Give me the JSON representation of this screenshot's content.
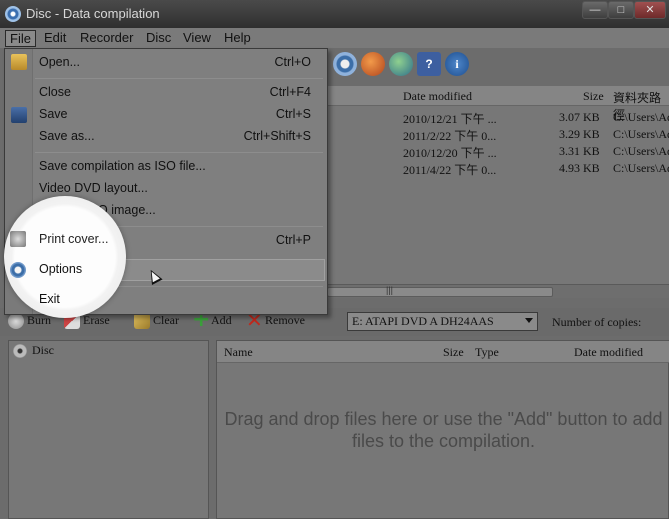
{
  "window": {
    "title": "Disc - Data compilation",
    "controls": [
      "—",
      "□",
      "✕"
    ]
  },
  "menubar": {
    "items": [
      "File",
      "Edit",
      "Recorder",
      "Disc",
      "View",
      "Help"
    ]
  },
  "file_menu": {
    "items": [
      {
        "label": "Open...",
        "shortcut": "Ctrl+O",
        "icon": "folder-icon"
      },
      {
        "label": "Close",
        "shortcut": "Ctrl+F4"
      },
      {
        "label": "Save",
        "shortcut": "Ctrl+S",
        "icon": "floppy-icon"
      },
      {
        "label": "Save as...",
        "shortcut": "Ctrl+Shift+S"
      },
      {
        "label": "Save compilation as ISO file..."
      },
      {
        "label": "Video DVD layout..."
      },
      {
        "label": "Convert ISO image..."
      },
      {
        "label": "Print cover...",
        "shortcut": "Ctrl+P",
        "icon": "printer-icon"
      },
      {
        "label": "Options",
        "icon": "gear-icon"
      },
      {
        "label": "Exit"
      }
    ]
  },
  "top_list": {
    "columns": {
      "date": "Date modified",
      "size": "Size",
      "path": "資料夾路徑"
    },
    "rows": [
      {
        "date": "2010/12/21 下午 ...",
        "size": "3.07 KB",
        "path": "C:\\Users\\Ad"
      },
      {
        "date": "2011/2/22 下午 0...",
        "size": "3.29 KB",
        "path": "C:\\Users\\Ad"
      },
      {
        "date": "2010/12/20 下午 ...",
        "size": "3.31 KB",
        "path": "C:\\Users\\Ad"
      },
      {
        "date": "2011/4/22 下午 0...",
        "size": "4.93 KB",
        "path": "C:\\Users\\Ad"
      }
    ],
    "scroll_glyph": "|||"
  },
  "bottom_toolbar": {
    "burn": "Burn",
    "erase": "Erase",
    "clear": "Clear",
    "add": "Add",
    "remove": "Remove",
    "drive": "E: ATAPI DVD A  DH24AAS",
    "copies_label": "Number of copies:"
  },
  "tree": {
    "root": "Disc"
  },
  "compilation": {
    "columns": {
      "name": "Name",
      "size": "Size",
      "type": "Type",
      "date": "Date modified"
    },
    "drop_message": "Drag and drop files here or use the \"Add\" button to add files to the compilation."
  },
  "colors": {
    "accent_blue": "#3c6ea8",
    "spotlight": "#fdfdfd",
    "add_green": "#3aa03a",
    "remove_red": "#c0281c"
  }
}
